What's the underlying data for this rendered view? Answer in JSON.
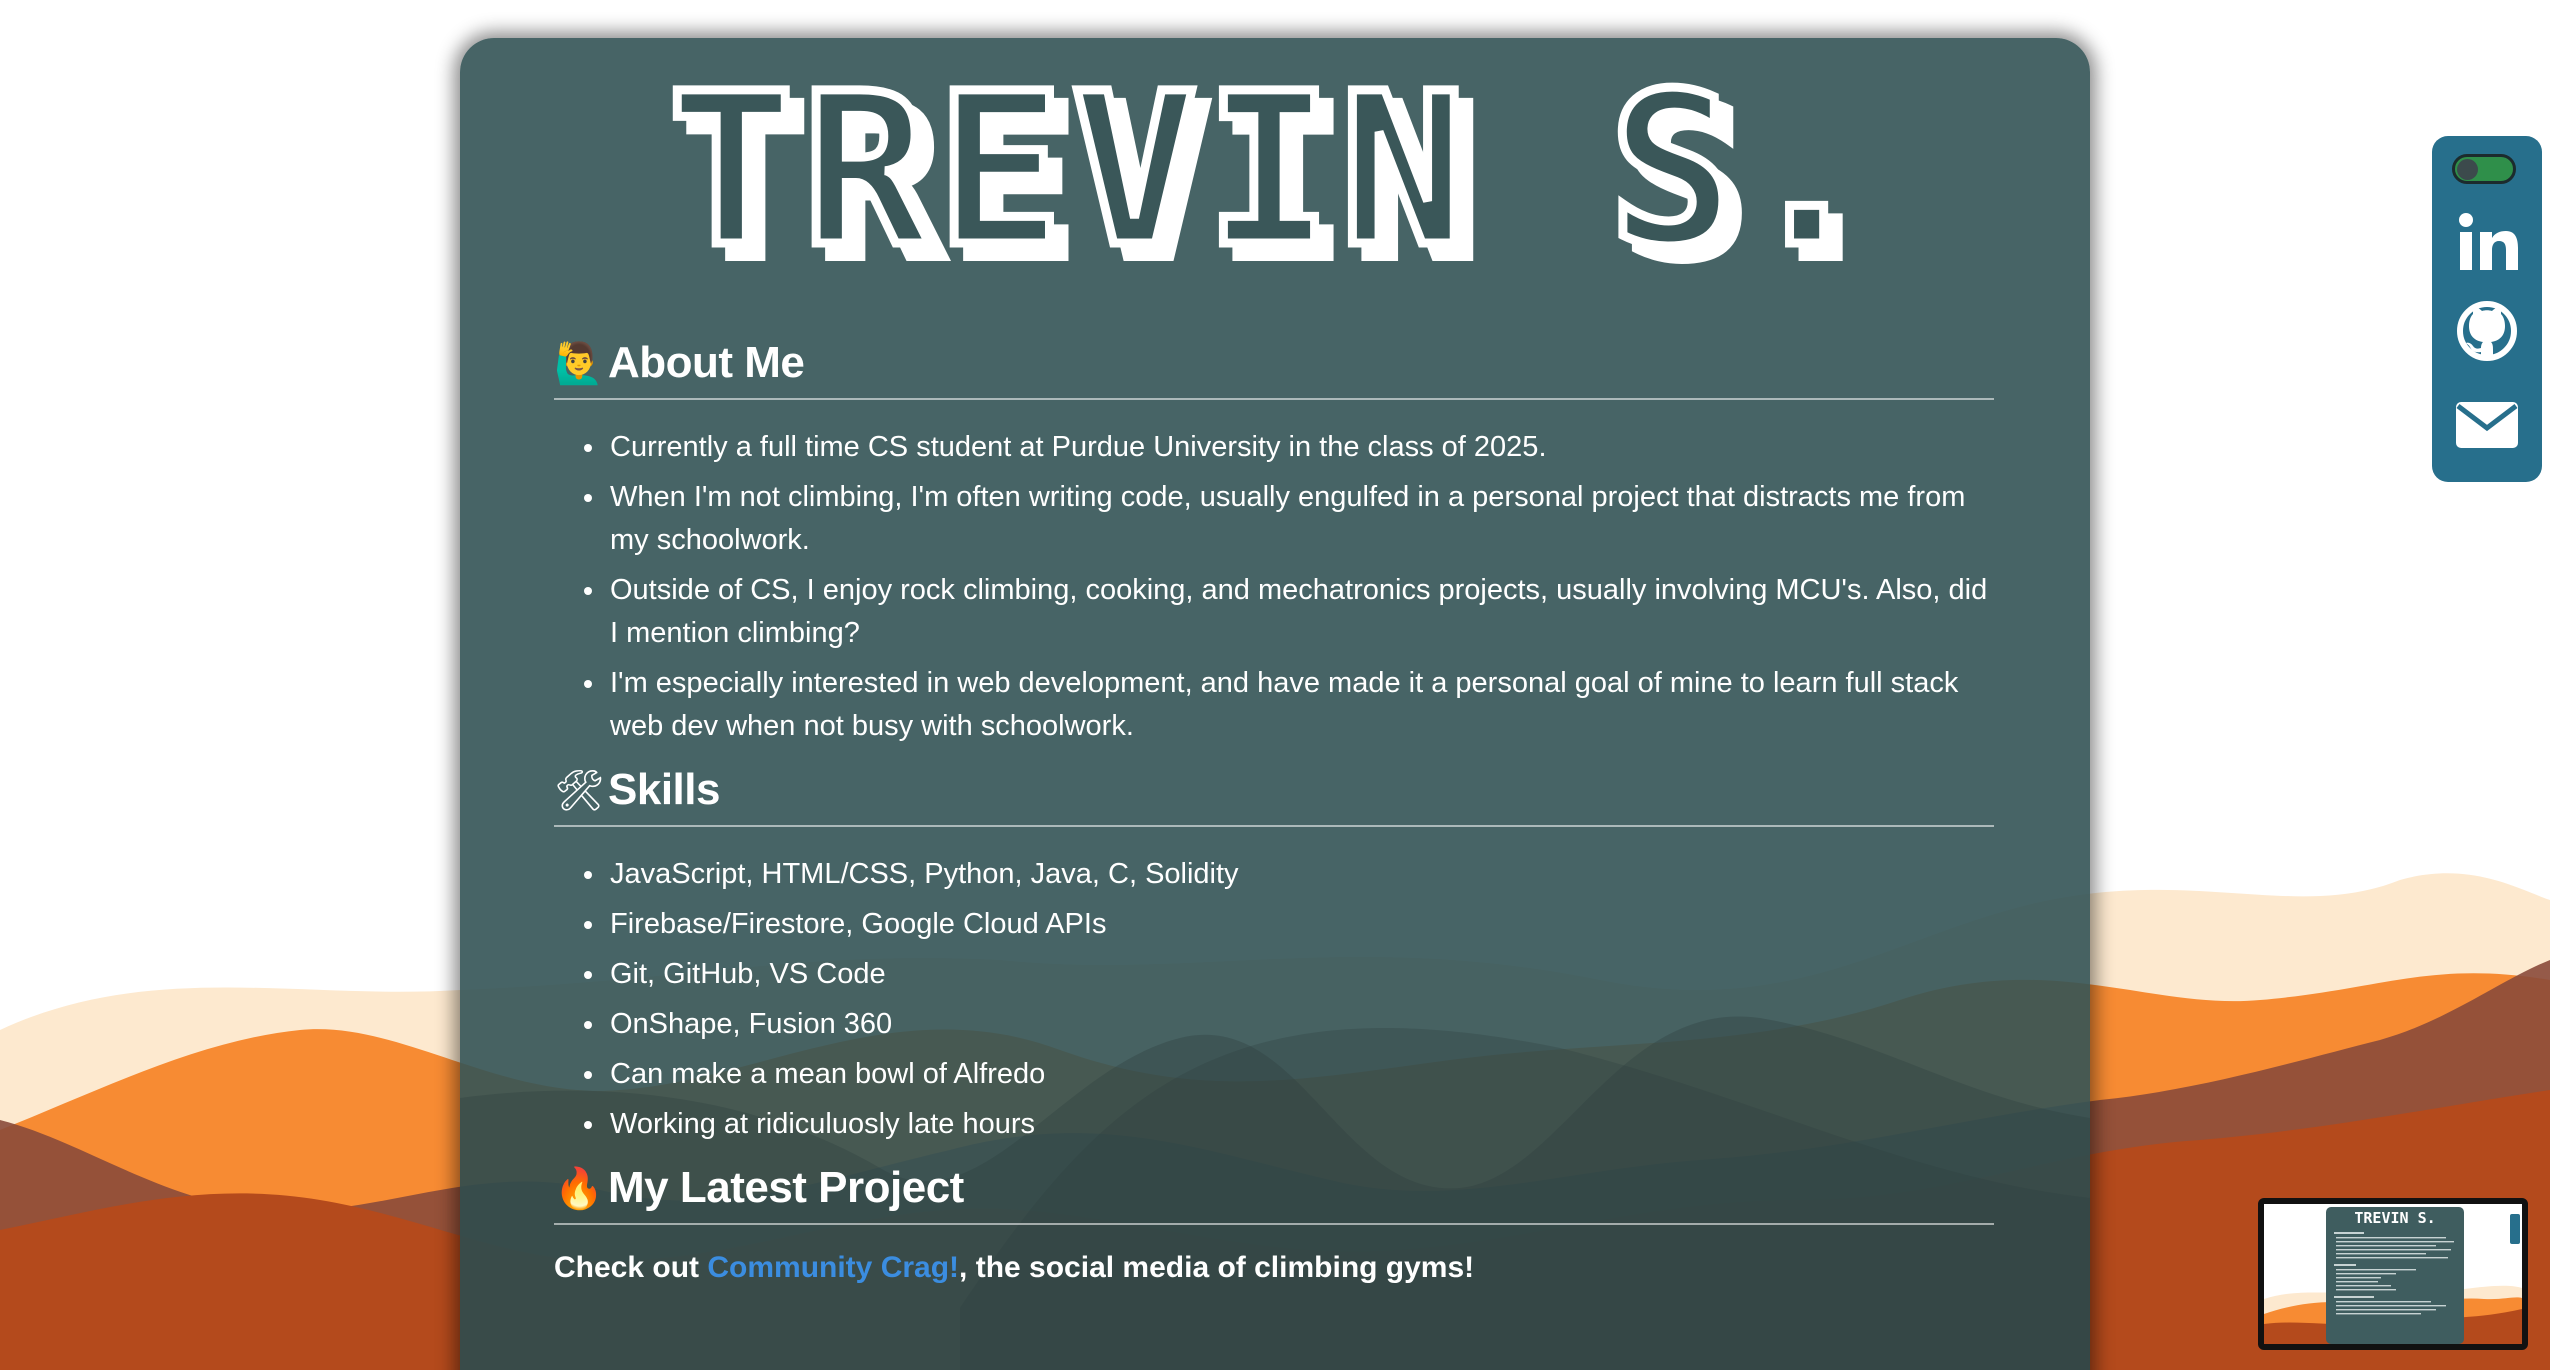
{
  "header": {
    "title": "TREVIN S."
  },
  "about": {
    "emoji": "🙋‍♂️",
    "heading": "About Me",
    "items": [
      "Currently a full time CS student at Purdue University in the class of 2025.",
      "When I'm not climbing, I'm often writing code, usually engulfed in a personal project that distracts me from my schoolwork.",
      "Outside of CS, I enjoy rock climbing, cooking, and mechatronics projects, usually involving MCU's. Also, did I mention climbing?",
      "I'm especially interested in web development, and have made it a personal goal of mine to learn full stack web dev when not busy with schoolwork."
    ]
  },
  "skills": {
    "emoji": "🛠",
    "heading": "Skills",
    "items": [
      "JavaScript, HTML/CSS, Python, Java, C, Solidity",
      "Firebase/Firestore, Google Cloud APIs",
      "Git, GitHub, VS Code",
      "OnShape, Fusion 360",
      "Can make a mean bowl of Alfredo",
      "Working at ridiculuosly late hours"
    ]
  },
  "project": {
    "emoji": "🔥",
    "heading": "My Latest Project",
    "prefix": "Check out ",
    "link_text": "Community Crag!",
    "suffix": ", the social media of climbing gyms!"
  },
  "social": {
    "icons": [
      "theme-toggle",
      "linkedin-icon",
      "github-icon",
      "mail-icon"
    ]
  },
  "minimap": {
    "title": "TREVIN S."
  },
  "colors": {
    "card": "#335355",
    "hill_light": "#fde9cf",
    "hill_orange": "#f78b33",
    "hill_rust": "#b44a1c",
    "hill_brown": "#8a4a3a",
    "link": "#3b8de0",
    "social_bg": "#276f8c",
    "toggle_on": "#2f8f4a"
  }
}
